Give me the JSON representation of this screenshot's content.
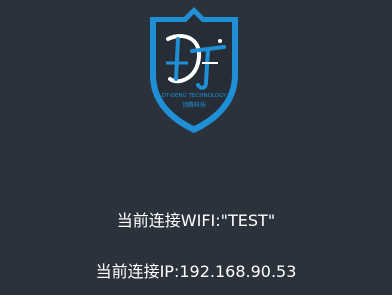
{
  "logo": {
    "icon": "dt-shield-logo",
    "line1": "DT-DENG TECHNOLOGY",
    "line2": "顶腾科技",
    "colors": {
      "shield": "#1f8fd6",
      "monogram": "#ffffff"
    }
  },
  "connection": {
    "wifi_text": "当前连接WIFI:\"TEST\"",
    "ip_text": "当前连接IP:192.168.90.53"
  }
}
